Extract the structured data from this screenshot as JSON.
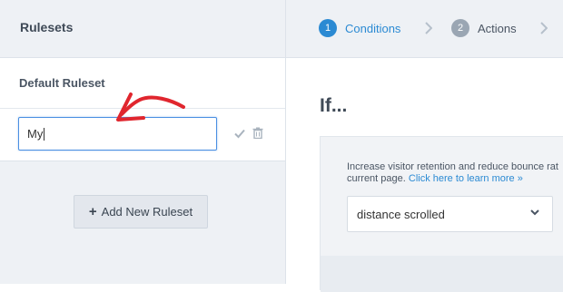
{
  "rulesets": {
    "title": "Rulesets",
    "default_label": "Default Ruleset",
    "edit_value": "My",
    "add_button_label": "Add New Ruleset"
  },
  "steps": [
    {
      "number": "1",
      "label": "Conditions",
      "active": true
    },
    {
      "number": "2",
      "label": "Actions",
      "active": false
    }
  ],
  "condition": {
    "heading": "If...",
    "description_line1": "Increase visitor retention and reduce bounce rat",
    "description_line2_prefix": "current page.",
    "description_link": "Click here to learn more »",
    "select_value": "distance scrolled"
  },
  "colors": {
    "accent": "#2b8ad3",
    "annotation_arrow": "#e0262e"
  },
  "icons": [
    "check-icon",
    "trash-icon",
    "plus-icon",
    "chevron-right-icon",
    "chevron-down-icon"
  ]
}
